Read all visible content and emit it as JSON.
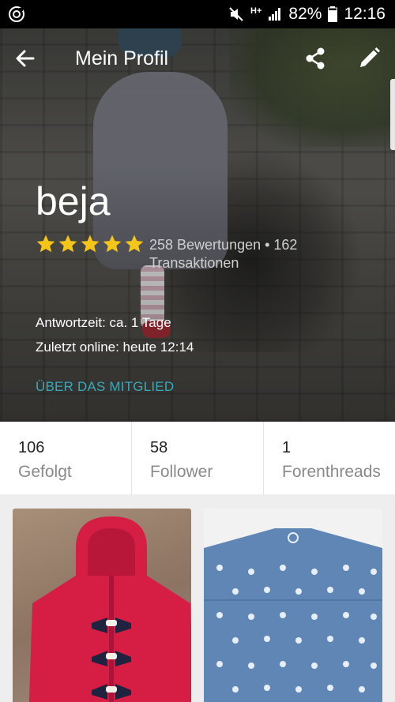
{
  "status_bar": {
    "network": "H+",
    "battery": "82%",
    "time": "12:16"
  },
  "toolbar": {
    "title": "Mein Profil"
  },
  "profile": {
    "name": "beja",
    "rating_stars": 5,
    "rating_text": "258 Bewertungen • 162 Transaktionen",
    "response_time": "Antwortzeit:  ca. 1 Tage",
    "last_online": "Zuletzt online: heute 12:14",
    "about_link": "ÜBER DAS MITGLIED"
  },
  "stats": [
    {
      "number": "106",
      "label": "Gefolgt"
    },
    {
      "number": "58",
      "label": "Follower"
    },
    {
      "number": "1",
      "label": "Forenthreads"
    }
  ],
  "colors": {
    "accent": "#3aa8b8",
    "star": "#f5c518"
  },
  "icons": [
    "app-icon",
    "mute-icon",
    "signal-icon",
    "battery-icon",
    "back-arrow-icon",
    "share-icon",
    "edit-icon",
    "star-icon"
  ]
}
